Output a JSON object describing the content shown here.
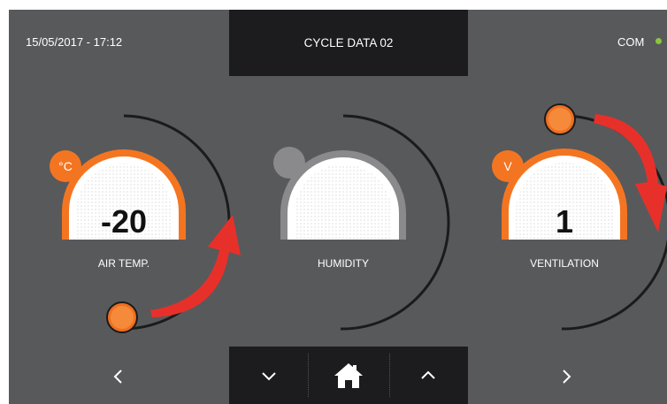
{
  "header": {
    "datetime": "15/05/2017 - 17:12",
    "title": "CYCLE DATA 02",
    "com_label": "COM",
    "com_status_color": "#8cc63f"
  },
  "gauges": [
    {
      "id": "air-temp",
      "label": "AIR TEMP.",
      "value": "-20",
      "unit": "°C",
      "active": true,
      "accent": "#f47521"
    },
    {
      "id": "humidity",
      "label": "HUMIDITY",
      "value": "",
      "unit": "",
      "active": false,
      "accent": "#8a8a8c"
    },
    {
      "id": "ventilation",
      "label": "VENTILATION",
      "value": "1",
      "unit": "V",
      "active": true,
      "accent": "#f47521"
    }
  ],
  "nav": {
    "prev_icon": "chevron-left-icon",
    "next_icon": "chevron-right-icon",
    "down_icon": "chevron-down-icon",
    "home_icon": "home-icon",
    "up_icon": "chevron-up-icon"
  },
  "colors": {
    "background": "#58595b",
    "panel": "#1c1c1e",
    "accent": "#f47521",
    "arrow": "#e8302a"
  }
}
